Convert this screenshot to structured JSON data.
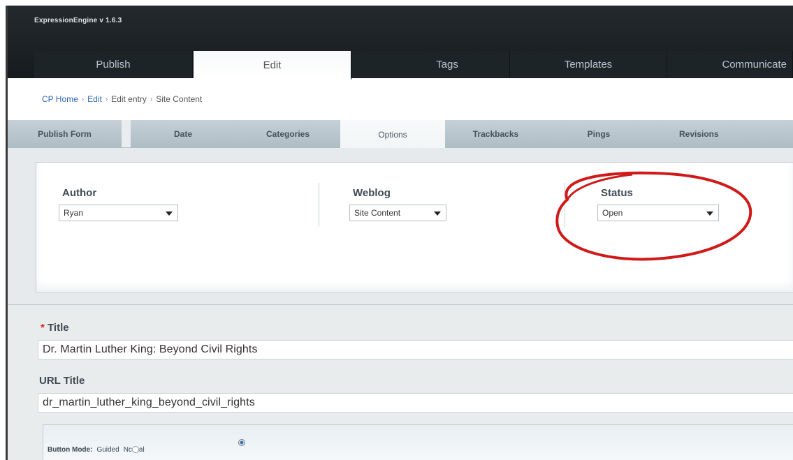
{
  "app": {
    "title": "ExpressionEngine v 1.6.3"
  },
  "main_tabs": [
    {
      "label": "Publish"
    },
    {
      "label": "Edit"
    },
    {
      "label": "Tags"
    },
    {
      "label": "Templates"
    },
    {
      "label": "Communicate"
    }
  ],
  "breadcrumb": {
    "items": [
      "CP Home",
      "Edit",
      "Edit entry",
      "Site Content"
    ],
    "separator": "›"
  },
  "sub_tabs": [
    {
      "label": "Publish Form"
    },
    {
      "label": "Date"
    },
    {
      "label": "Categories"
    },
    {
      "label": "Options"
    },
    {
      "label": "Trackbacks"
    },
    {
      "label": "Pings"
    },
    {
      "label": "Revisions"
    }
  ],
  "options": {
    "author": {
      "label": "Author",
      "value": "Ryan"
    },
    "weblog": {
      "label": "Weblog",
      "value": "Site Content"
    },
    "status": {
      "label": "Status",
      "value": "Open"
    }
  },
  "fields": {
    "title": {
      "required_mark": "*",
      "label": "Title",
      "value": "Dr. Martin Luther King: Beyond Civil Rights"
    },
    "url_title": {
      "label": "URL Title",
      "value": "dr_martin_luther_king_beyond_civil_rights"
    }
  },
  "format_bar": {
    "button_mode_label": "Button Mode:",
    "guided_label": "Guided",
    "normal_label": "Nc",
    "normal_label_tail": "al"
  },
  "colors": {
    "header_bg": "#1b2125",
    "link": "#2f68b3",
    "required": "#d12b1f",
    "highlight_ellipse": "#d01a1a"
  }
}
